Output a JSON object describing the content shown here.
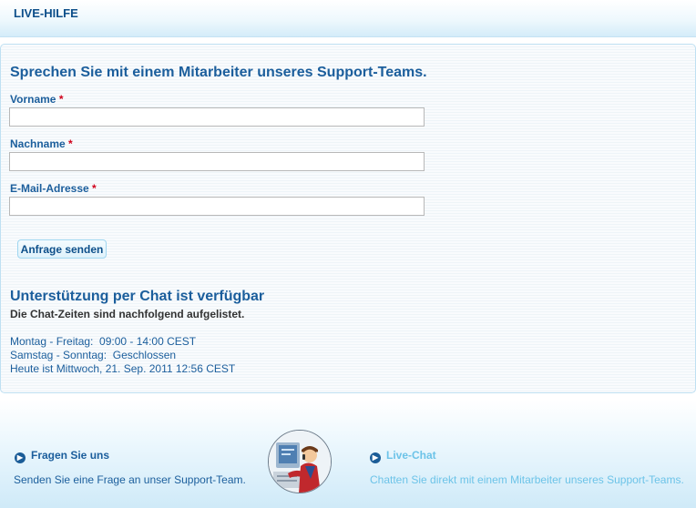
{
  "header": {
    "title": "LIVE-HILFE"
  },
  "form": {
    "title": "Sprechen Sie mit einem Mitarbeiter unseres Support-Teams.",
    "required_marker": "*",
    "fields": [
      {
        "label": "Vorname",
        "value": ""
      },
      {
        "label": "Nachname",
        "value": ""
      },
      {
        "label": "E-Mail-Adresse",
        "value": ""
      }
    ],
    "submit_label": "Anfrage senden"
  },
  "chat": {
    "title": "Unterstützung per Chat ist verfügbar",
    "subtitle": "Die Chat-Zeiten sind nachfolgend aufgelistet.",
    "hours": [
      "Montag - Freitag:  09:00 - 14:00 CEST",
      "Samstag - Sonntag:  Geschlossen",
      "Heute ist Mittwoch, 21. Sep. 2011 12:56 CEST"
    ]
  },
  "footer": {
    "left": {
      "link": "Fragen Sie uns",
      "description": "Senden Sie eine Frage an unser Support-Team."
    },
    "right": {
      "link": "Live-Chat",
      "description": "Chatten Sie direkt mit einem Mitarbeiter unseres Support-Teams."
    }
  },
  "colors": {
    "primary": "#1b5e9c",
    "required": "#d0021b",
    "inactive_link": "#6cc3e8"
  }
}
